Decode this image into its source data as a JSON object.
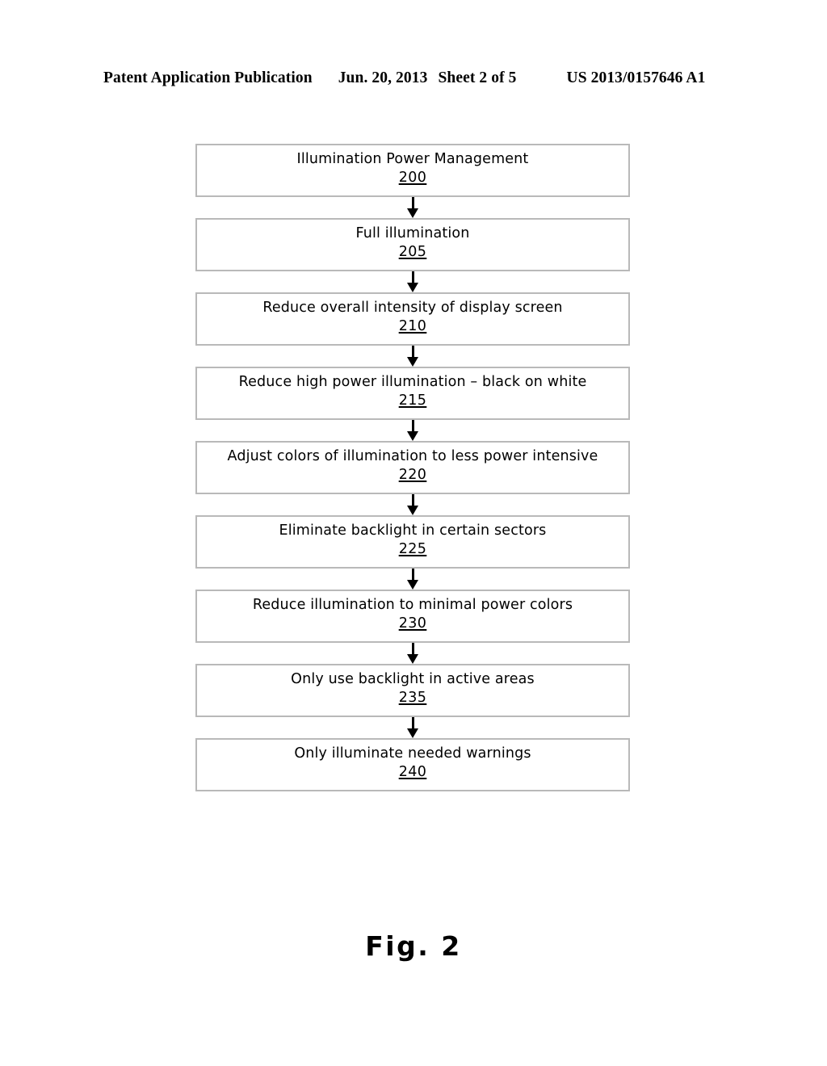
{
  "header": {
    "publication": "Patent Application Publication",
    "date": "Jun. 20, 2013",
    "sheet": "Sheet 2 of 5",
    "document_number": "US 2013/0157646 A1"
  },
  "figure": {
    "caption": "Fig. 2",
    "border_color": "#b9b9b9",
    "line_color": "#000000"
  },
  "flowchart": {
    "type": "flowchart",
    "orientation": "vertical",
    "connector": "down-arrow",
    "steps": [
      {
        "label": "Illumination Power Management",
        "ref": "200"
      },
      {
        "label": "Full illumination",
        "ref": "205"
      },
      {
        "label": "Reduce overall intensity of display screen",
        "ref": "210"
      },
      {
        "label": "Reduce high power illumination – black on white",
        "ref": "215"
      },
      {
        "label": "Adjust colors of illumination to less power intensive",
        "ref": "220"
      },
      {
        "label": "Eliminate backlight in certain sectors",
        "ref": "225"
      },
      {
        "label": "Reduce illumination to minimal power colors",
        "ref": "230"
      },
      {
        "label": "Only use backlight in active areas",
        "ref": "235"
      },
      {
        "label": "Only illuminate needed warnings",
        "ref": "240"
      }
    ]
  }
}
